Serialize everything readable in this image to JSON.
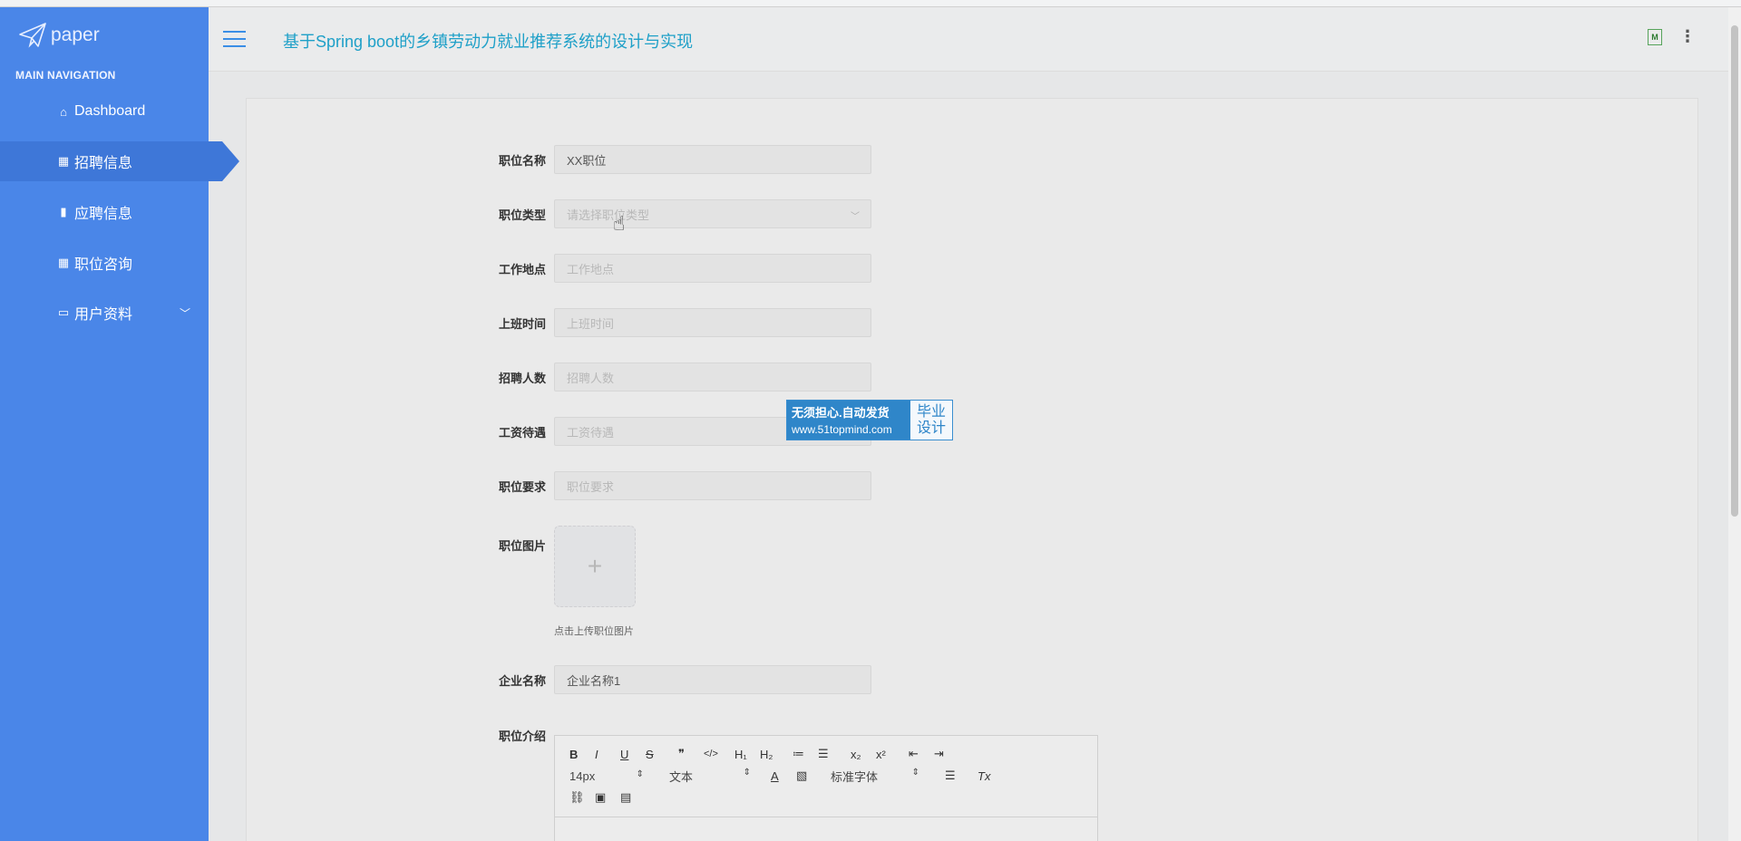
{
  "brand": {
    "name": "paper",
    "icon": "paper-plane-icon"
  },
  "sidebar": {
    "header": "MAIN NAVIGATION",
    "items": [
      {
        "label": "Dashboard",
        "icon": "home-icon"
      },
      {
        "label": "招聘信息",
        "icon": "grid-icon",
        "active": true
      },
      {
        "label": "应聘信息",
        "icon": "book-icon"
      },
      {
        "label": "职位咨询",
        "icon": "grid-icon"
      },
      {
        "label": "用户资料",
        "icon": "card-icon",
        "chevron": "chevron-down-icon"
      }
    ]
  },
  "header": {
    "title": "基于Spring boot的乡镇劳动力就业推荐系统的设计与实现"
  },
  "form": {
    "job_name": {
      "label": "职位名称",
      "value": "XX职位"
    },
    "job_type": {
      "label": "职位类型",
      "placeholder": "请选择职位类型"
    },
    "location": {
      "label": "工作地点",
      "placeholder": "工作地点"
    },
    "work_time": {
      "label": "上班时间",
      "placeholder": "上班时间"
    },
    "headcount": {
      "label": "招聘人数",
      "placeholder": "招聘人数"
    },
    "salary": {
      "label": "工资待遇",
      "placeholder": "工资待遇"
    },
    "requirements": {
      "label": "职位要求",
      "placeholder": "职位要求"
    },
    "image": {
      "label": "职位图片",
      "hint": "点击上传职位图片",
      "plus": "+"
    },
    "company": {
      "label": "企业名称",
      "value": "企业名称1"
    },
    "intro": {
      "label": "职位介绍"
    }
  },
  "editor": {
    "row1": [
      "B",
      "I",
      "U",
      "S",
      "❞",
      "</>",
      "H₁",
      "H₂",
      "≔",
      "☰",
      "x₂",
      "x²",
      "⇤",
      "⇥"
    ],
    "font_size": "14px",
    "text_type": "文本",
    "font_family": "标准字体",
    "color_btn": "A",
    "clear_btn": "Tx"
  },
  "watermark": {
    "line1": "无须担心.自动发货",
    "line2": "www.51topmind.com",
    "right1": "毕业",
    "right2": "设计"
  },
  "topbar": {
    "avatar_text": "M",
    "more": "⋮"
  }
}
